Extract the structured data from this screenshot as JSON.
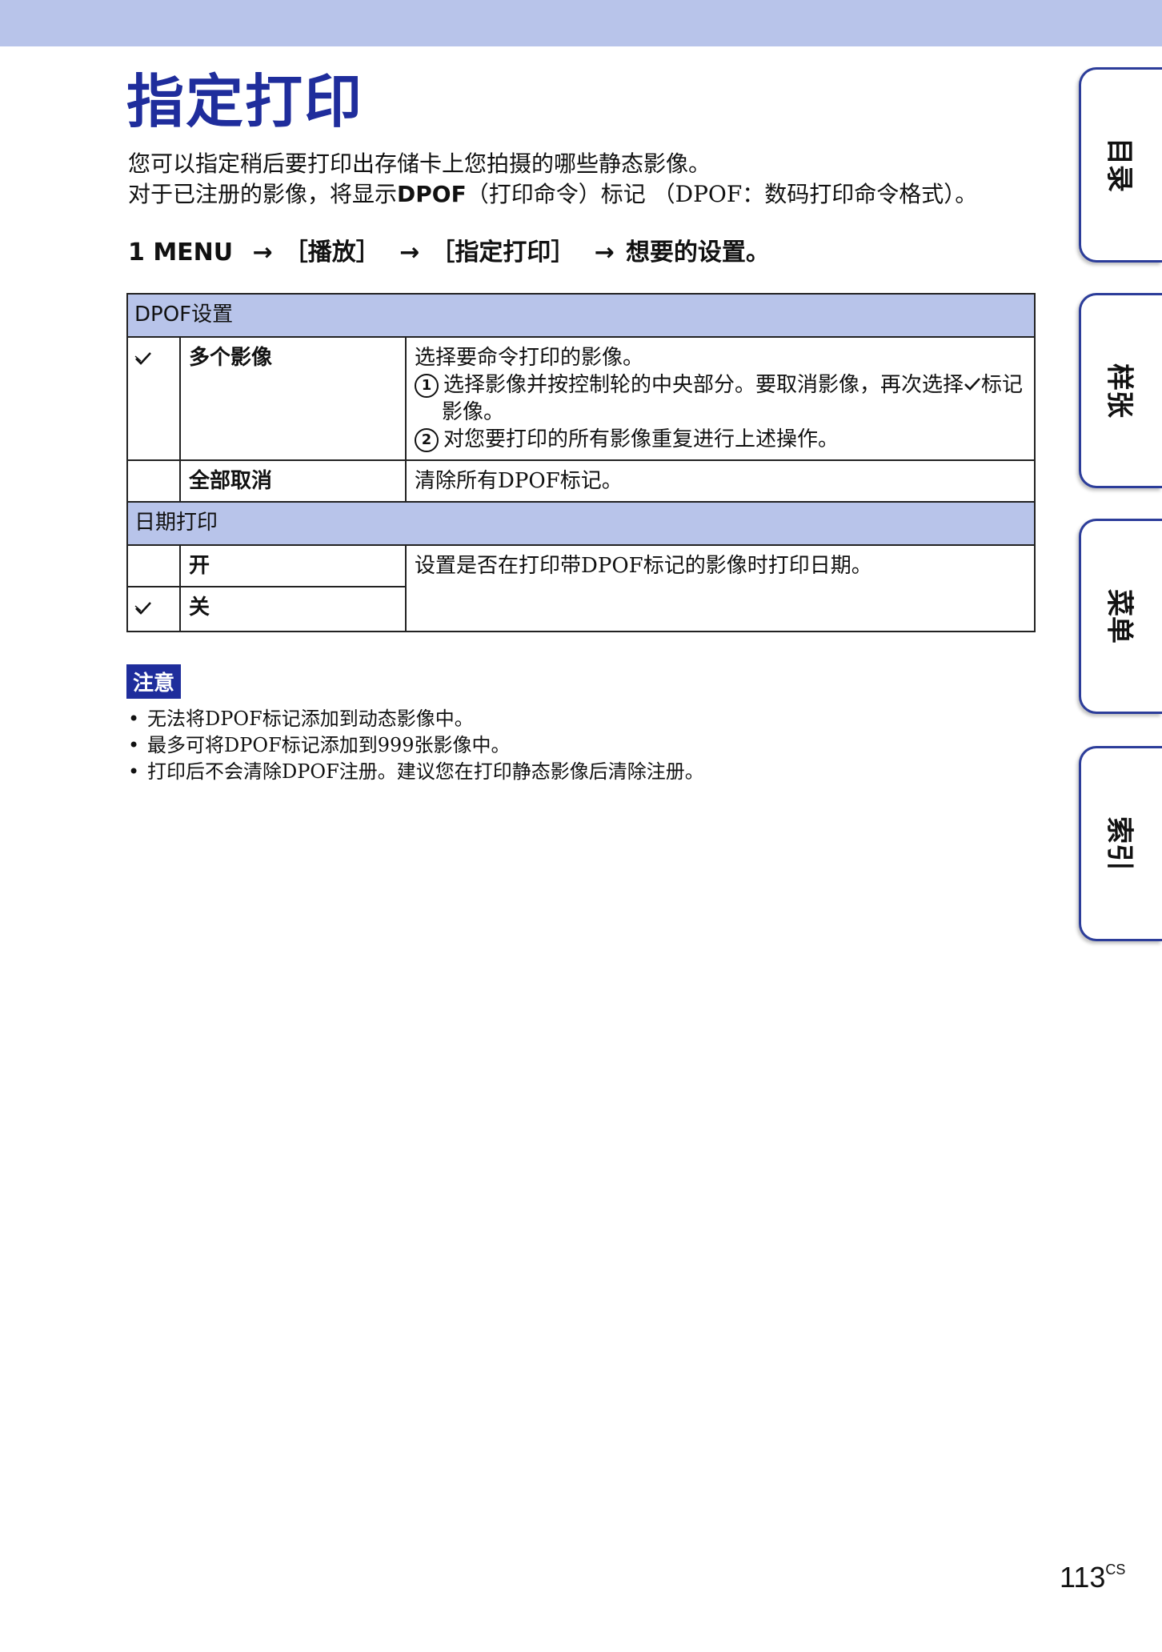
{
  "title": "指定打印",
  "intro": {
    "line1": "您可以指定稍后要打印出存储卡上您拍摄的哪些静态影像。",
    "line2_pre": "对于已注册的影像，将显示",
    "line2_bold": "DPOF",
    "line2_post": "（打印命令）标记 （DPOF：数码打印命令格式）。"
  },
  "step": {
    "num": "1",
    "menu": "MENU",
    "arrow": "→",
    "item1": "［播放］",
    "item2": "［指定打印］",
    "item3": "想要的设置。"
  },
  "table": {
    "section1": {
      "header": "DPOF设置",
      "row1": {
        "name": "多个影像",
        "desc": "选择要命令打印的影像。",
        "step1_num": "1",
        "step1": "选择影像并按控制轮的中央部分。要取消影像，再次选择",
        "step1_tail": "标记影像。",
        "step2_num": "2",
        "step2": "对您要打印的所有影像重复进行上述操作。"
      },
      "row2": {
        "name": "全部取消",
        "desc": "清除所有DPOF标记。"
      }
    },
    "section2": {
      "header": "日期打印",
      "row1": {
        "name": "开",
        "desc": "设置是否在打印带DPOF标记的影像时打印日期。"
      },
      "row2": {
        "name": "关"
      }
    }
  },
  "notes": {
    "label": "注意",
    "items": [
      "无法将DPOF标记添加到动态影像中。",
      "最多可将DPOF标记添加到999张影像中。",
      "打印后不会清除DPOF注册。建议您在打印静态影像后清除注册。"
    ]
  },
  "tabs": [
    "目录",
    "样张",
    "菜单",
    "索引"
  ],
  "page": {
    "number": "113",
    "suffix": "CS"
  },
  "colors": {
    "accent": "#1f2d9c",
    "band": "#b8c4ea"
  },
  "icons": {
    "check": "check-icon"
  }
}
